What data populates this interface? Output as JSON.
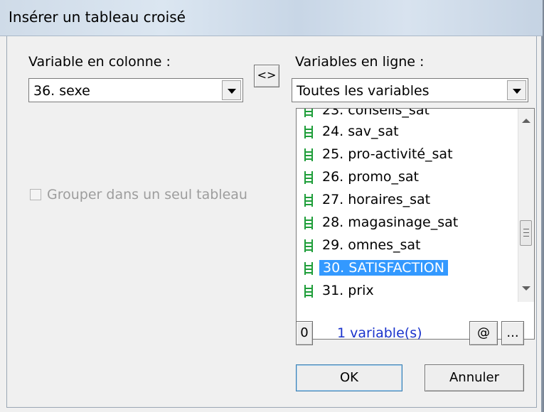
{
  "window": {
    "title": "Insérer un tableau croisé"
  },
  "column_section": {
    "label": "Variable en colonne :",
    "selected": "36. sexe"
  },
  "swap_button": {
    "label": "<>"
  },
  "row_section": {
    "label": "Variables en ligne :",
    "filter_selected": "Toutes les variables"
  },
  "group_checkbox": {
    "label": "Grouper dans un seul tableau",
    "checked": false,
    "enabled": false
  },
  "variable_list": {
    "partial_top_item": "23. conseils_sat",
    "items": [
      {
        "label": "24. sav_sat",
        "selected": false
      },
      {
        "label": "25. pro-activité_sat",
        "selected": false
      },
      {
        "label": "26. promo_sat",
        "selected": false
      },
      {
        "label": "27. horaires_sat",
        "selected": false
      },
      {
        "label": "28. magasinage_sat",
        "selected": false
      },
      {
        "label": "29. omnes_sat",
        "selected": false
      },
      {
        "label": "30. SATISFACTION",
        "selected": true
      },
      {
        "label": "31. prix",
        "selected": false
      }
    ]
  },
  "footer": {
    "zero_button": "0",
    "count_text": "1 variable(s)",
    "at_button": "@",
    "more_button": "...",
    "ok_button": "OK",
    "cancel_button": "Annuler"
  },
  "colors": {
    "selection": "#3399ff",
    "count_text": "#1a33cc",
    "icon_green": "#1f9e3a"
  }
}
